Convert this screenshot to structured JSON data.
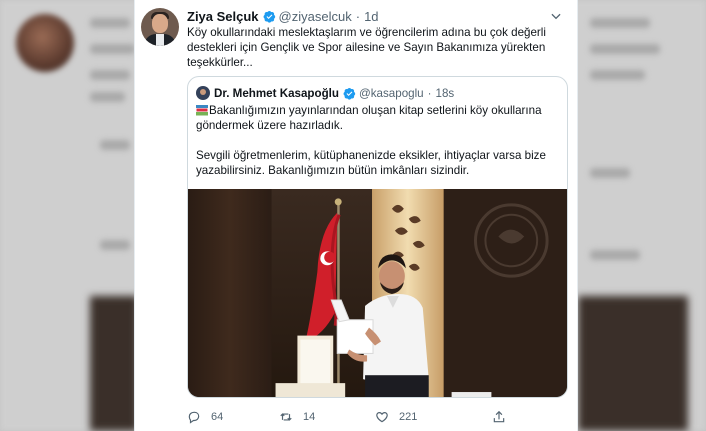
{
  "tweet": {
    "author_name": "Ziya Selçuk",
    "author_handle": "@ziyaselcuk",
    "separator": "·",
    "time": "1d",
    "text": "Köy okullarındaki meslektaşlarım ve öğrencilerim adına bu çok değerli destekleri için Gençlik ve Spor ailesine ve Sayın Bakanımıza yürekten teşekkürler...",
    "icons": {
      "verified": "verified-badge-icon",
      "more": "chevron-down-icon"
    },
    "colors": {
      "verified": "#1d9bf0",
      "muted": "#536471"
    }
  },
  "quote": {
    "author_name": "Dr. Mehmet Kasapoğlu",
    "author_handle": "@kasapoglu",
    "separator": "·",
    "time": "18s",
    "text_line1": "Bakanlığımızın yayınlarından oluşan kitap setlerini köy okullarına göndermek üzere hazırladık.",
    "text_line2": "Sevgili öğretmenlerim, kütüphanenizde eksikler, ihtiyaçlar varsa bize yazabilirsiniz. Bakanlığımızın bütün imkânları sizindir.",
    "icons": {
      "emoji": "books-emoji-icon"
    },
    "photo": {
      "alt": "Minister holding a book box in office with Turkish flag"
    }
  },
  "actions": {
    "reply_count": "64",
    "retweet_count": "14",
    "like_count": "221",
    "icons": [
      "reply-icon",
      "retweet-icon",
      "like-icon",
      "share-icon"
    ]
  }
}
